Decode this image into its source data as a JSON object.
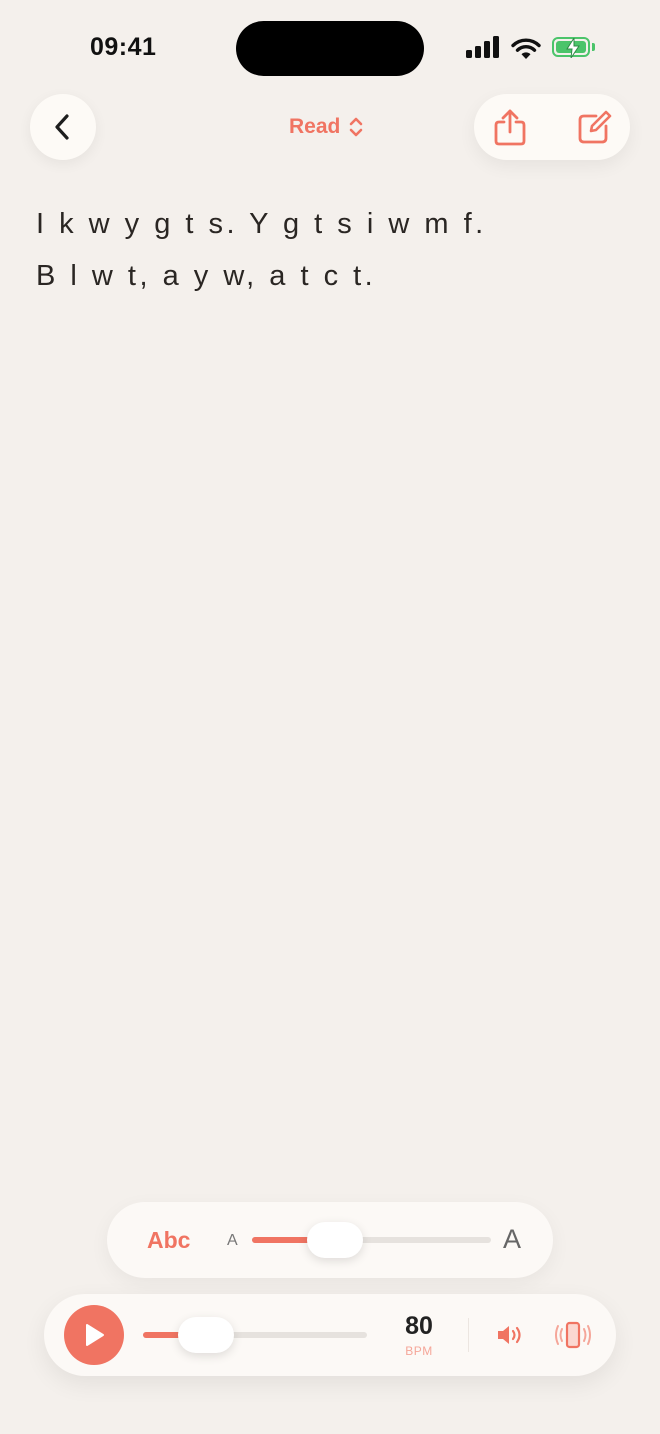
{
  "status_bar": {
    "time": "09:41"
  },
  "header": {
    "mode_label": "Read"
  },
  "content": {
    "lines": [
      "I k w y g t s. Y g t s i w m f.",
      "B l w t, a y w, a t c t."
    ]
  },
  "font_panel": {
    "sample_label": "Abc",
    "small_glyph": "A",
    "large_glyph": "A",
    "size_level_fraction": 0.27
  },
  "player": {
    "tempo_value": "80",
    "tempo_unit": "BPM",
    "tempo_level_fraction": 0.2
  },
  "colors": {
    "accent": "#f07462",
    "background": "#f4f0ec",
    "battery": "#4bc46a"
  },
  "icons": [
    "back-chevron-icon",
    "up-down-chevron-icon",
    "share-icon",
    "edit-icon",
    "play-icon",
    "speaker-icon",
    "vibrate-icon"
  ]
}
